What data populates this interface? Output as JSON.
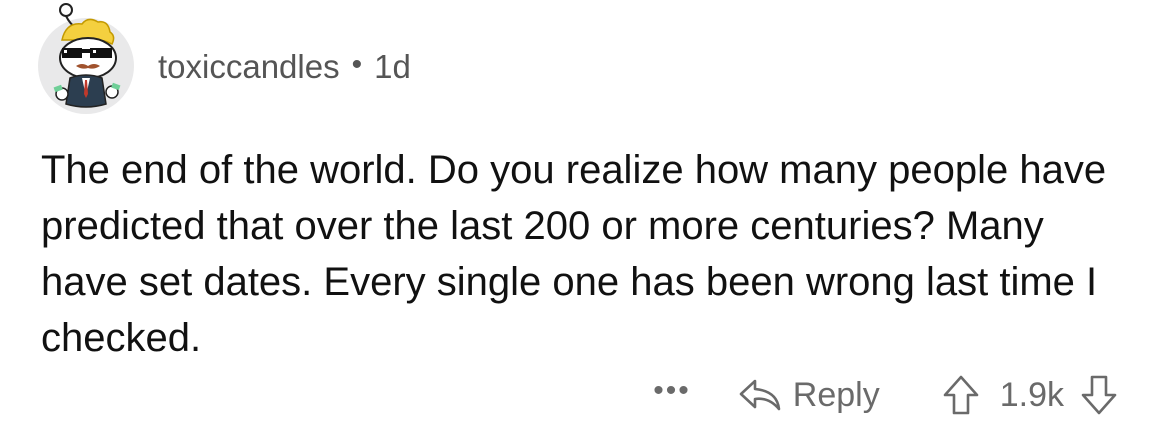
{
  "comment": {
    "username": "toxiccandles",
    "separator": "•",
    "age": "1d",
    "body": "The end of the world. Do you realize how many people have predicted that over the last 200 or more centuries? Many have set dates. Every single one has been wrong last time I checked."
  },
  "actions": {
    "more_label": "•••",
    "reply_label": "Reply",
    "score": "1.9k",
    "upvote_icon": "arrow-up-outline",
    "downvote_icon": "arrow-down-outline",
    "reply_icon": "reply-arrow"
  },
  "colors": {
    "text": "#111111",
    "meta": "#555555",
    "action": "#6a6a6a",
    "avatar_bg": "#e9e9ea"
  }
}
